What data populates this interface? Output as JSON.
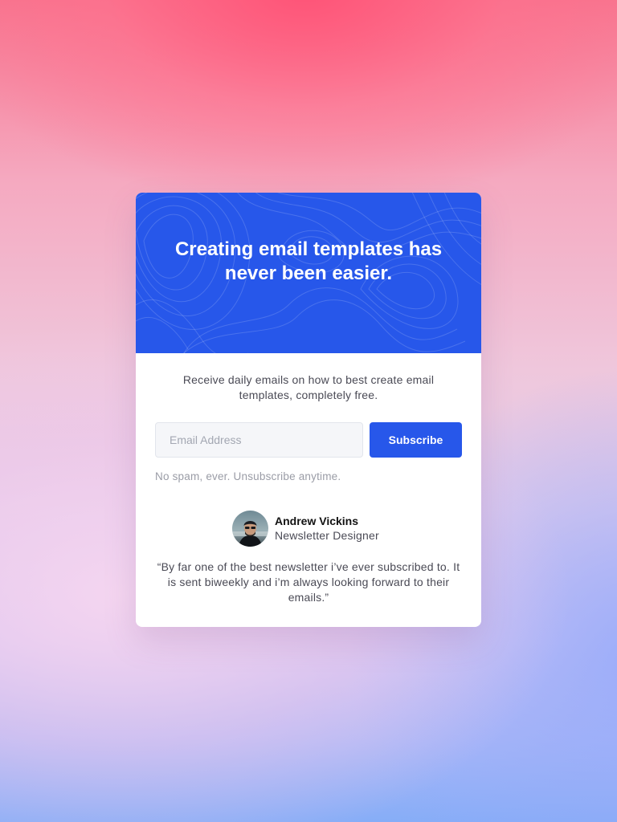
{
  "hero": {
    "title": "Creating email templates has never been easier."
  },
  "intro": {
    "text": "Receive daily emails on how to best create email templates, completely free."
  },
  "form": {
    "email_placeholder": "Email Address",
    "email_value": "",
    "subscribe_label": "Subscribe"
  },
  "note": {
    "text": "No spam, ever. Unsubscribe anytime."
  },
  "testimonial": {
    "name": "Andrew Vickins",
    "role": "Newsletter Designer",
    "quote": "“By far one of the best newsletter i’ve ever subscribed to. It is sent biweekly and i’m always looking forward to their emails.”"
  },
  "colors": {
    "accent": "#2757ea",
    "card_bg": "#ffffff",
    "input_bg": "#f5f6f9"
  }
}
